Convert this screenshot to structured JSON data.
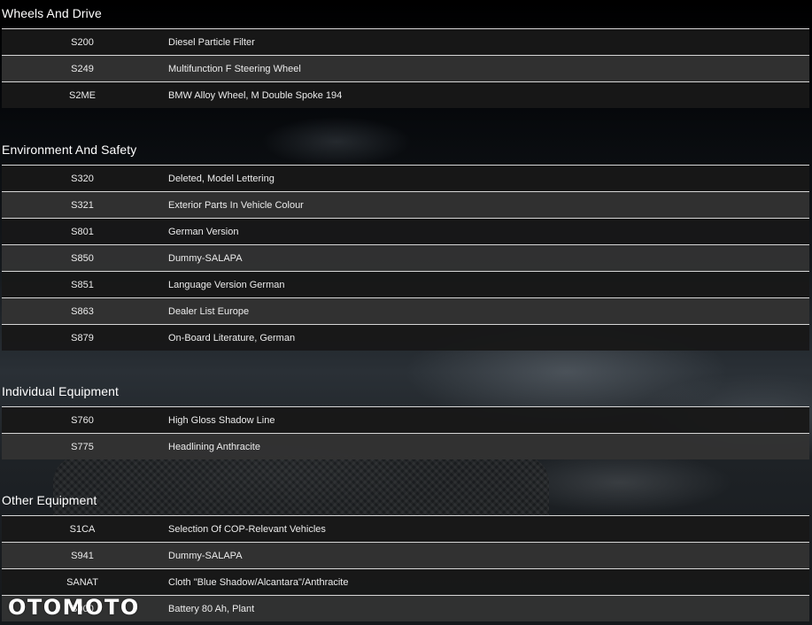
{
  "sections": [
    {
      "title": "Wheels And Drive",
      "rows": [
        {
          "code": "S200",
          "desc": "Diesel Particle Filter"
        },
        {
          "code": "S249",
          "desc": "Multifunction F Steering Wheel"
        },
        {
          "code": "S2ME",
          "desc": "BMW Alloy Wheel, M Double Spoke 194"
        }
      ]
    },
    {
      "title": "Environment And Safety",
      "rows": [
        {
          "code": "S320",
          "desc": "Deleted, Model Lettering"
        },
        {
          "code": "S321",
          "desc": "Exterior Parts In Vehicle Colour"
        },
        {
          "code": "S801",
          "desc": "German Version"
        },
        {
          "code": "S850",
          "desc": "Dummy-SALAPA"
        },
        {
          "code": "S851",
          "desc": "Language Version German"
        },
        {
          "code": "S863",
          "desc": "Dealer List Europe"
        },
        {
          "code": "S879",
          "desc": "On-Board Literature, German"
        }
      ]
    },
    {
      "title": "Individual Equipment",
      "rows": [
        {
          "code": "S760",
          "desc": "High Gloss Shadow Line"
        },
        {
          "code": "S775",
          "desc": "Headlining Anthracite"
        }
      ]
    },
    {
      "title": "Other Equipment",
      "rows": [
        {
          "code": "S1CA",
          "desc": "Selection Of COP-Relevant Vehicles"
        },
        {
          "code": "S941",
          "desc": "Dummy-SALAPA"
        },
        {
          "code": "SANAT",
          "desc": "Cloth \"Blue Shadow/Alcantara\"/Anthracite"
        },
        {
          "code": "S000",
          "desc": "Battery 80 Ah, Plant"
        }
      ]
    }
  ],
  "watermark": "OTOMOTO",
  "colors": {
    "row_dark": "#181818",
    "row_light": "#323232",
    "divider": "#d6d6d6",
    "text": "#ececec"
  }
}
